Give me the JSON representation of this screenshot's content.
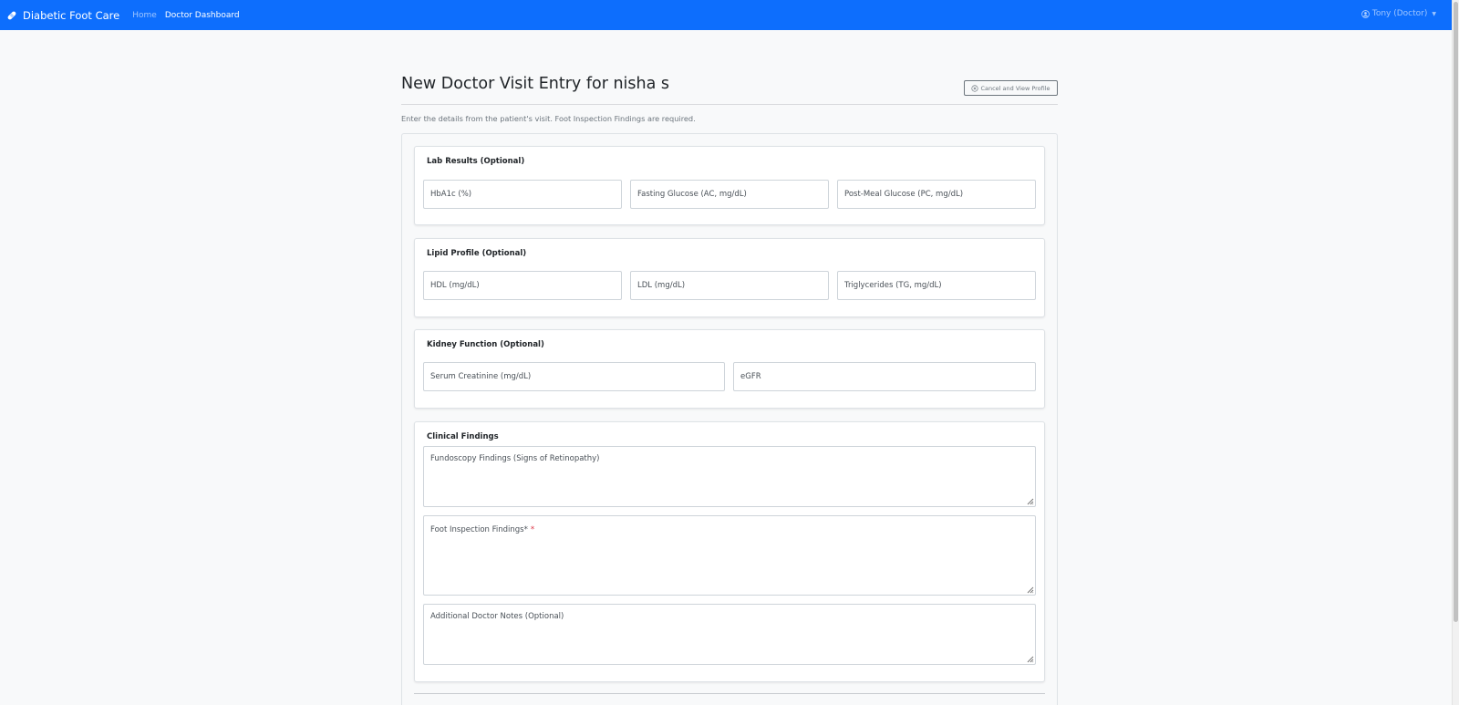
{
  "navbar": {
    "brand": "Diabetic Foot Care",
    "brand_icon": "bandage-icon",
    "links": [
      "Home",
      "Doctor Dashboard"
    ],
    "user": "Tony (Doctor)",
    "colors": {
      "bg": "#0d6efd"
    }
  },
  "header": {
    "title": "New Doctor Visit Entry for nisha s",
    "cancel_label": "Cancel and View Profile",
    "intro": "Enter the details from the patient's visit. Foot Inspection Findings are required."
  },
  "sections": {
    "lab": {
      "title": "Lab Results (Optional)",
      "fields": [
        "HbA1c (%)",
        "Fasting Glucose (AC, mg/dL)",
        "Post-Meal Glucose (PC, mg/dL)"
      ]
    },
    "lipid": {
      "title": "Lipid Profile (Optional)",
      "fields": [
        "HDL (mg/dL)",
        "LDL (mg/dL)",
        "Triglycerides (TG, mg/dL)"
      ]
    },
    "kidney": {
      "title": "Kidney Function (Optional)",
      "fields": [
        "Serum Creatinine (mg/dL)",
        "eGFR"
      ]
    },
    "clinical": {
      "title": "Clinical Findings",
      "fundoscopy": "Fundoscopy Findings (Signs of Retinopathy)",
      "foot": "Foot Inspection Findings*",
      "required_mark": "*",
      "notes": "Additional Doctor Notes (Optional)"
    }
  }
}
